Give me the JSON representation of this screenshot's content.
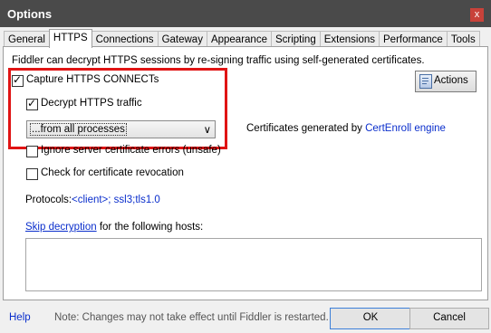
{
  "window": {
    "title": "Options",
    "close_glyph": "x"
  },
  "tabs": [
    {
      "label": "General"
    },
    {
      "label": "HTTPS"
    },
    {
      "label": "Connections"
    },
    {
      "label": "Gateway"
    },
    {
      "label": "Appearance"
    },
    {
      "label": "Scripting"
    },
    {
      "label": "Extensions"
    },
    {
      "label": "Performance"
    },
    {
      "label": "Tools"
    }
  ],
  "active_tab": "HTTPS",
  "https": {
    "intro": "Fiddler can decrypt HTTPS sessions by re-signing traffic using self-generated certificates.",
    "capture": {
      "label": "Capture HTTPS CONNECTs",
      "checked": true
    },
    "decrypt": {
      "label": "Decrypt HTTPS traffic",
      "checked": true
    },
    "process_select": {
      "value": "...from all processes",
      "chevron": "∨"
    },
    "ignore_errors": {
      "label": "Ignore server certificate errors (unsafe)",
      "checked": false
    },
    "revocation": {
      "label": "Check for certificate revocation",
      "checked": false
    },
    "cert_text": "Certificates generated by",
    "cert_link": "CertEnroll engine",
    "actions_label": "Actions",
    "protocols_label": "Protocols:",
    "protocols_value": "<client>; ssl3;tls1.0",
    "skip_link": "Skip decryption",
    "skip_text": "for the following hosts:",
    "hosts_value": ""
  },
  "footer": {
    "help": "Help",
    "note": "Note: Changes may not take effect until Fiddler is restarted.",
    "ok": "OK",
    "cancel": "Cancel"
  },
  "colors": {
    "titlebar": "#4a4a4a",
    "highlight": "#e01414",
    "link": "#0a2ecc",
    "ok_border": "#3c7fd9"
  }
}
